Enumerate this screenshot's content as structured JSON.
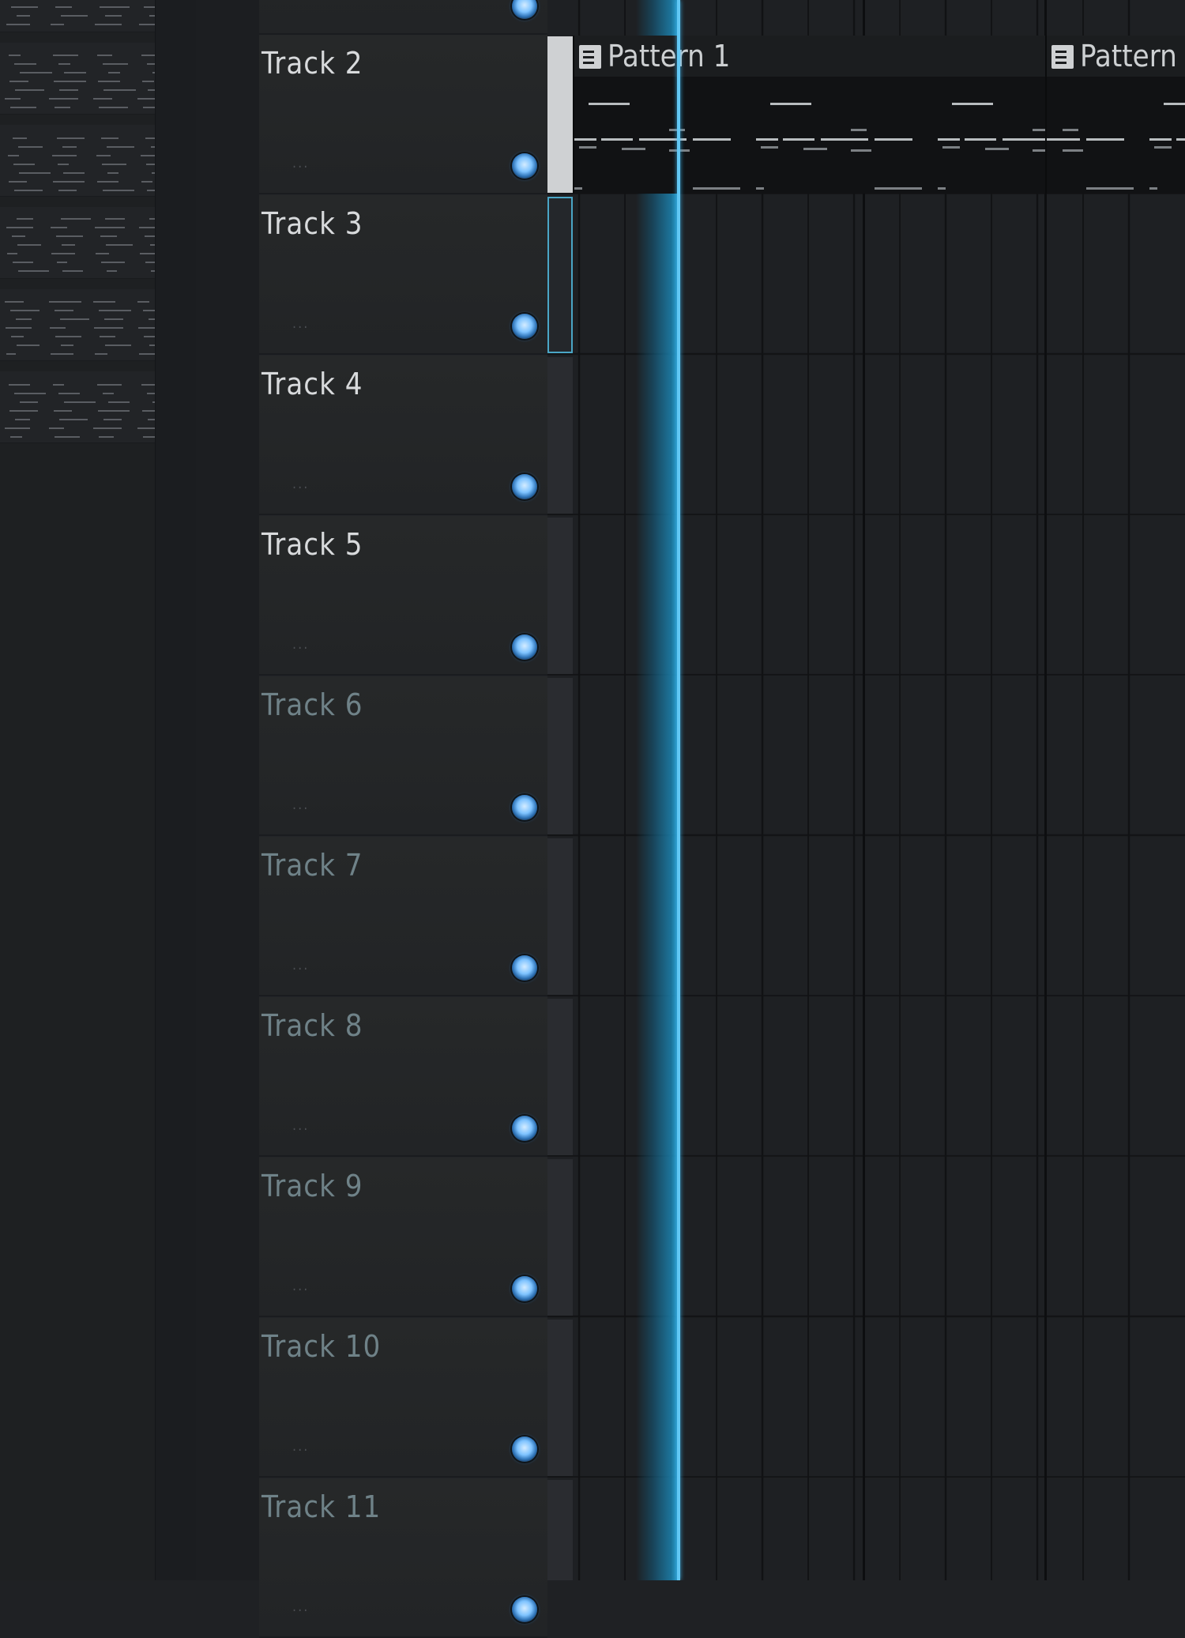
{
  "tracks": [
    {
      "label": "Track 2",
      "active": true
    },
    {
      "label": "Track 3",
      "active": true
    },
    {
      "label": "Track 4",
      "active": true
    },
    {
      "label": "Track 5",
      "active": true
    },
    {
      "label": "Track 6",
      "active": false
    },
    {
      "label": "Track 7",
      "active": false
    },
    {
      "label": "Track 8",
      "active": false
    },
    {
      "label": "Track 9",
      "active": false
    },
    {
      "label": "Track 10",
      "active": false
    },
    {
      "label": "Track 11",
      "active": false
    }
  ],
  "clips": [
    {
      "label": "Pattern 1",
      "track": "Track 2"
    },
    {
      "label": "Pattern",
      "track": "Track 2"
    }
  ],
  "colors": {
    "led": "#7ec3ff",
    "playhead": "#62c8f5",
    "active_text": "#d8dadc",
    "inactive_text": "#6f8288"
  },
  "icons": {
    "track_led": "led-icon",
    "clip_pattern": "pattern-icon"
  }
}
